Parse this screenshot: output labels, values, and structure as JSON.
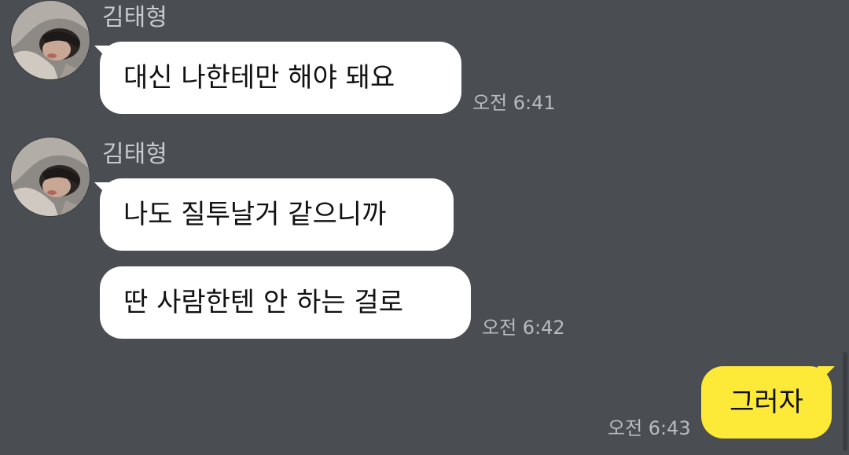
{
  "chat": {
    "groups": [
      {
        "sender": "김태형",
        "avatar_icon": "profile-photo",
        "messages": [
          {
            "text": "대신 나한테만 해야 돼요"
          }
        ],
        "time": "오전 6:41"
      },
      {
        "sender": "김태형",
        "avatar_icon": "profile-photo",
        "messages": [
          {
            "text": "나도 질투날거 같으니까"
          },
          {
            "text": "딴 사람한텐 안 하는 걸로"
          }
        ],
        "time": "오전 6:42"
      }
    ],
    "outgoing": {
      "messages": [
        {
          "text": "그러자"
        }
      ],
      "time": "오전 6:43"
    }
  },
  "colors": {
    "background": "#4a4d52",
    "incoming_bubble": "#ffffff",
    "outgoing_bubble": "#fdea38",
    "sender_name": "#c8cacd",
    "timestamp": "#b9bbbe"
  }
}
